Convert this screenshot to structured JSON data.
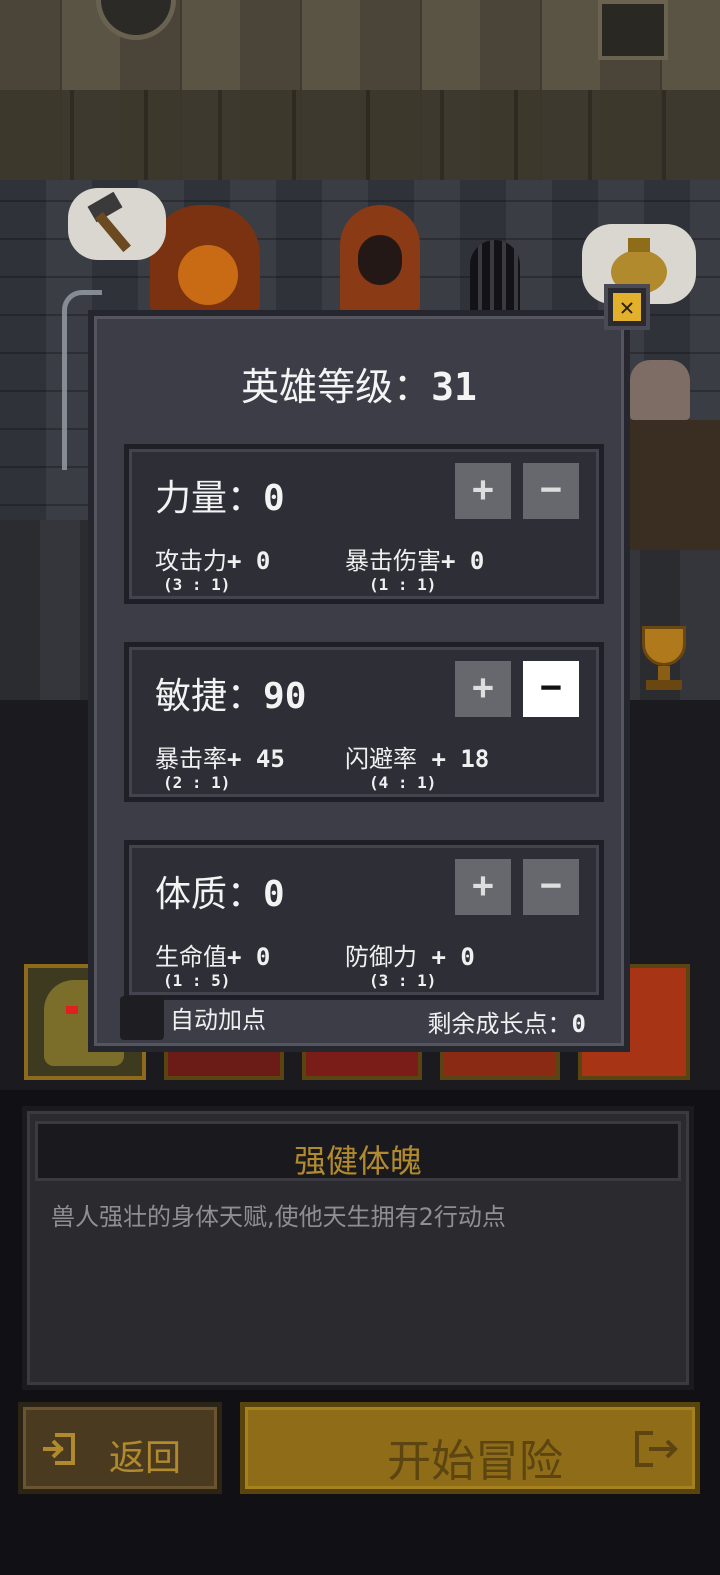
{
  "modal": {
    "title_label": "英雄等级：",
    "title_value": "31",
    "close_icon": "close-icon",
    "stats": [
      {
        "name": "力量：",
        "value": "0",
        "plus_label": "+",
        "minus_label": "−",
        "effect_a": "攻击力",
        "effect_a_value": "+ 0",
        "ratio_a": "(3 : 1)",
        "effect_b": "暴击伤害",
        "effect_b_value": "+ 0",
        "ratio_b": "(1 : 1)"
      },
      {
        "name": "敏捷：",
        "value": "90",
        "plus_label": "+",
        "minus_label": "−",
        "effect_a": "暴击率",
        "effect_a_value": "+ 45",
        "ratio_a": "(2 : 1)",
        "effect_b": "闪避率",
        "effect_b_value": " + 18",
        "ratio_b": "(4 : 1)"
      },
      {
        "name": "体质：",
        "value": "0",
        "plus_label": "+",
        "minus_label": "−",
        "effect_a": "生命值",
        "effect_a_value": "+ 0",
        "ratio_a": "(1 : 5)",
        "effect_b": "防御力",
        "effect_b_value": " + 0",
        "ratio_b": "(3 : 1)"
      }
    ],
    "auto_label": "自动加点",
    "remaining_label": "剩余成长点：",
    "remaining_value": "0"
  },
  "description": {
    "title": "强健体魄",
    "text": "兽人强壮的身体天赋,使他天生拥有2行动点"
  },
  "buttons": {
    "back_label": "返回",
    "start_label": "开始冒险"
  },
  "colors": {
    "accent_gold": "#b08a2c",
    "modal_bg": "#3d3d48"
  }
}
